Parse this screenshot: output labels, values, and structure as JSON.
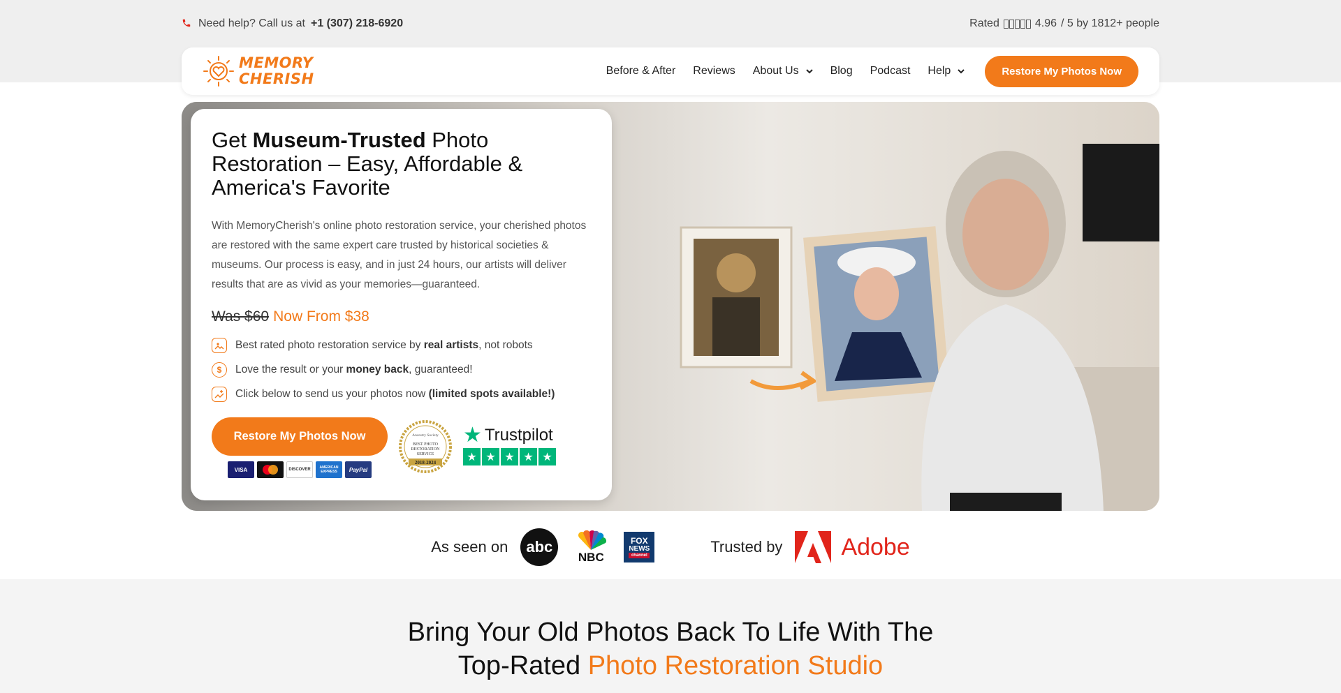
{
  "topbar": {
    "help_text": "Need help? Call us at",
    "phone": "+1 (307) 218-6920",
    "rated_label": "Rated",
    "rating_value": "4.96",
    "rating_scale": "/ 5 by 1812+ people"
  },
  "nav": {
    "logo_line1": "MEMORY",
    "logo_line2": "CHERISH",
    "items": [
      {
        "label": "Before & After"
      },
      {
        "label": "Reviews"
      },
      {
        "label": "About Us"
      },
      {
        "label": "Blog"
      },
      {
        "label": "Podcast"
      },
      {
        "label": "Help"
      }
    ],
    "cta": "Restore My Photos Now"
  },
  "hero": {
    "title_pre": "Get",
    "title_bold": "Museum-Trusted",
    "title_post": "Photo Restoration – Easy, Affordable & America's Favorite",
    "description": "With MemoryCherish's online photo restoration service, your cherished photos are restored with the same expert care trusted by historical societies & museums. Our process is easy, and in just 24 hours, our artists will deliver results that are as vivid as your memories—guaranteed.",
    "price_was": "Was $60",
    "price_now": "Now From $38",
    "features": [
      {
        "pre": "Best rated photo restoration service by",
        "bold": "real artists",
        "post": ", not robots"
      },
      {
        "pre": "Love the result or your",
        "bold": "money back",
        "post": ", guaranteed!"
      },
      {
        "pre": "Click below to send us your photos now",
        "bold": "(limited spots available!)",
        "post": ""
      }
    ],
    "cta": "Restore My Photos Now",
    "payment_cards": [
      "VISA",
      "MC",
      "DISCOVER",
      "AMERICAN EXPRESS",
      "PayPal"
    ],
    "badge_lines": [
      "Ancestry Society",
      "BEST PHOTO",
      "RESTORATION",
      "SERVICE",
      "2018-2024"
    ],
    "trustpilot": "Trustpilot",
    "slides": 4,
    "active_slide": 1
  },
  "seen_on": {
    "label": "As seen on",
    "abc": "abc",
    "nbc": "NBC",
    "fox_line1": "FOX",
    "fox_line2": "NEWS",
    "fox_line3": "channel",
    "trusted_label": "Trusted by",
    "adobe": "Adobe"
  },
  "section": {
    "heading_line1": "Bring Your Old Photos Back To Life With The",
    "heading_pre": "Top-Rated",
    "heading_highlight": "Photo Restoration Studio"
  },
  "colors": {
    "accent": "#f27a1a",
    "trustpilot_green": "#00b67a",
    "adobe_red": "#e1251b"
  }
}
